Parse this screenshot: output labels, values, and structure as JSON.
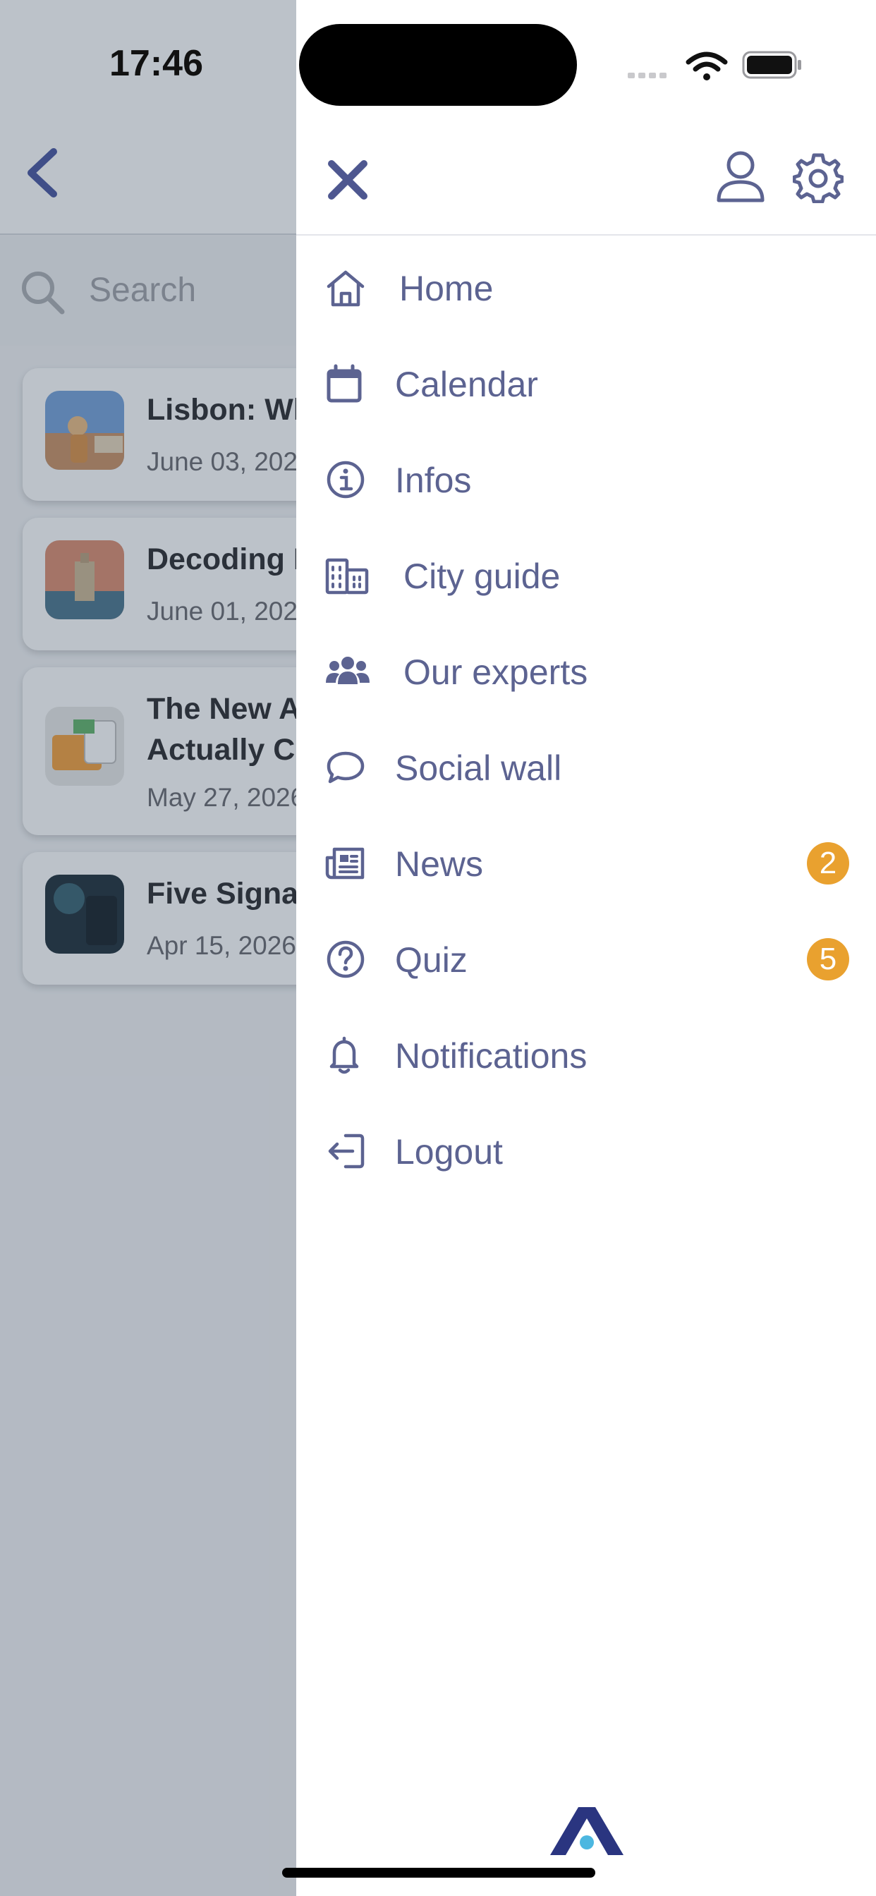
{
  "status_bar": {
    "time": "17:46"
  },
  "background_page": {
    "search_placeholder": "Search",
    "articles": [
      {
        "title": "Lisbon: Wh",
        "date": "June 03, 202"
      },
      {
        "title": "Decoding I",
        "date": "June 01, 202"
      },
      {
        "title": "The New A\nActually Cl",
        "date": "May 27, 2026"
      },
      {
        "title": "Five Signa",
        "date": "Apr 15, 2026,"
      }
    ]
  },
  "drawer": {
    "menu": [
      {
        "label": "Home",
        "icon": "home-icon"
      },
      {
        "label": "Calendar",
        "icon": "calendar-icon"
      },
      {
        "label": "Infos",
        "icon": "info-icon"
      },
      {
        "label": "City guide",
        "icon": "city-guide-icon"
      },
      {
        "label": "Our experts",
        "icon": "experts-icon"
      },
      {
        "label": "Social wall",
        "icon": "chat-bubble-icon"
      },
      {
        "label": "News",
        "icon": "newspaper-icon",
        "badge": "2"
      },
      {
        "label": "Quiz",
        "icon": "question-icon",
        "badge": "5"
      },
      {
        "label": "Notifications",
        "icon": "bell-icon"
      },
      {
        "label": "Logout",
        "icon": "logout-icon"
      }
    ]
  },
  "colors": {
    "menu_text": "#5c6391",
    "badge": "#e9a12f",
    "brand_navy": "#2a3580",
    "brand_accent": "#4cb7e0"
  }
}
